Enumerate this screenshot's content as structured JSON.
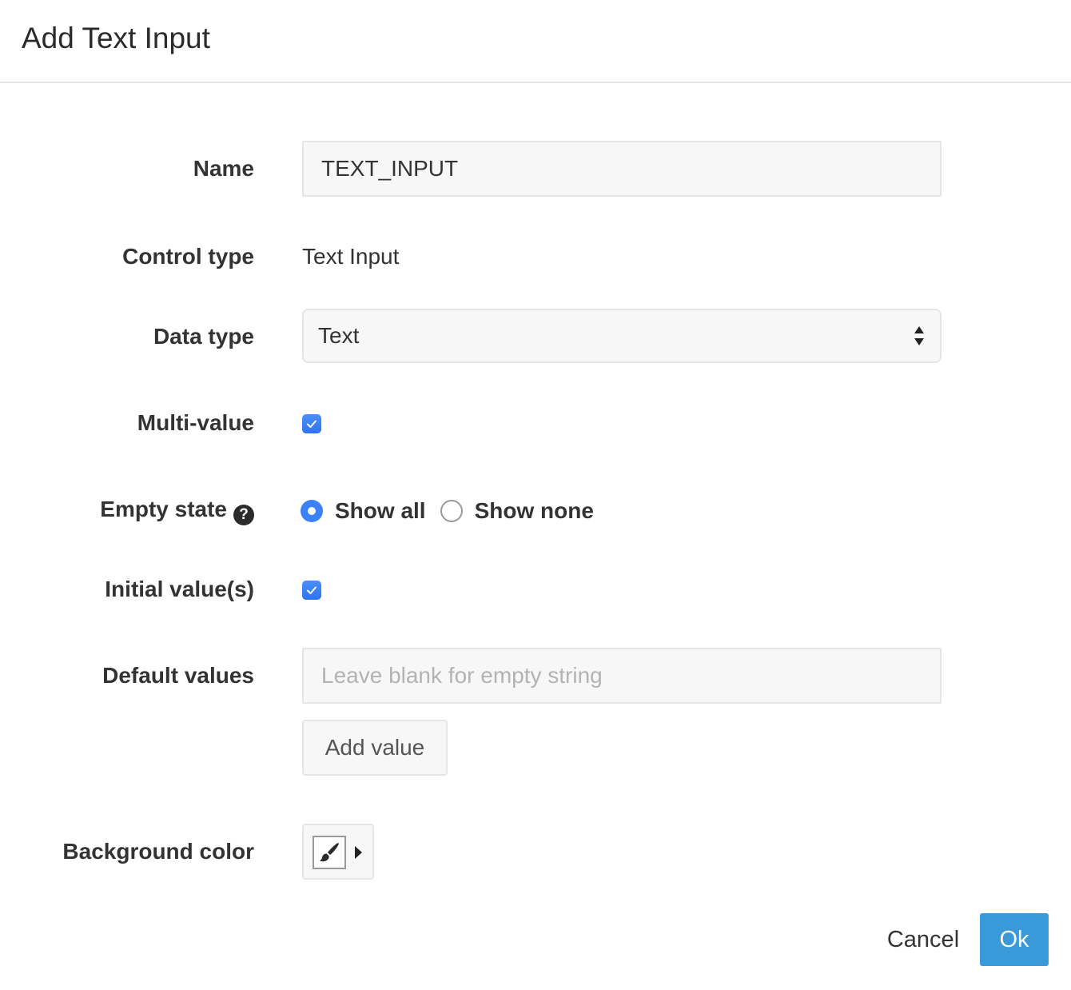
{
  "dialog": {
    "title": "Add Text Input"
  },
  "form": {
    "name": {
      "label": "Name",
      "value": "TEXT_INPUT"
    },
    "control_type": {
      "label": "Control type",
      "value": "Text Input"
    },
    "data_type": {
      "label": "Data type",
      "selected": "Text"
    },
    "multi_value": {
      "label": "Multi-value",
      "checked": true
    },
    "empty_state": {
      "label": "Empty state",
      "help_icon": "question-circle-icon",
      "options": [
        {
          "label": "Show all",
          "selected": true
        },
        {
          "label": "Show none",
          "selected": false
        }
      ]
    },
    "initial_values": {
      "label": "Initial value(s)",
      "checked": true
    },
    "default_values": {
      "label": "Default values",
      "placeholder": "Leave blank for empty string",
      "value": "",
      "add_button": "Add value"
    },
    "background_color": {
      "label": "Background color",
      "icon": "paint-brush-icon",
      "dropdown_icon": "caret-right-icon"
    }
  },
  "footer": {
    "cancel_label": "Cancel",
    "ok_label": "Ok"
  },
  "colors": {
    "accent": "#3b82f6",
    "ok_button": "#3a99d8",
    "input_background": "#f7f7f7",
    "input_border": "#e6e6e6"
  }
}
